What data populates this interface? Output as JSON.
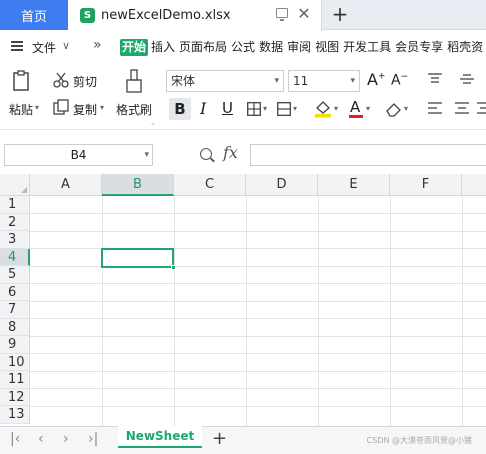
{
  "tabs": {
    "home_label": "首页",
    "doc_icon": "S",
    "doc_title": "newExcelDemo.xlsx",
    "close_glyph": "✕",
    "add_glyph": "+"
  },
  "menu": {
    "file_label": "文件",
    "more_glyph": "»",
    "tabs": [
      "开始",
      "插入",
      "页面布局",
      "公式",
      "数据",
      "审阅",
      "视图",
      "开发工具",
      "会员专享",
      "稻壳资"
    ]
  },
  "ribbon": {
    "cut_label": "剪切",
    "paste_label": "粘贴",
    "copy_label": "复制",
    "format_painter_label": "格式刷",
    "font_name": "宋体",
    "font_size": "11",
    "bold": "B",
    "italic": "I",
    "underline": "U",
    "grow_font": "A",
    "shrink_font": "A",
    "font_color_glyph": "A"
  },
  "formula_bar": {
    "cell_ref": "B4",
    "fx": "fx",
    "value": ""
  },
  "grid": {
    "columns": [
      "A",
      "B",
      "C",
      "D",
      "E",
      "F"
    ],
    "rows": [
      "1",
      "2",
      "3",
      "4",
      "5",
      "6",
      "7",
      "8",
      "9",
      "10",
      "11",
      "12",
      "13"
    ],
    "selected_column": "B",
    "selected_row": "4"
  },
  "sheets": {
    "active": "NewSheet",
    "add_glyph": "+",
    "nav": [
      "|<",
      "<",
      ">",
      ">|"
    ]
  },
  "watermark": "CSDN @大漠苍雨风景@小猪",
  "colors": {
    "accent_green": "#1fa86b",
    "home_tab_blue": "#3f7cf0"
  }
}
